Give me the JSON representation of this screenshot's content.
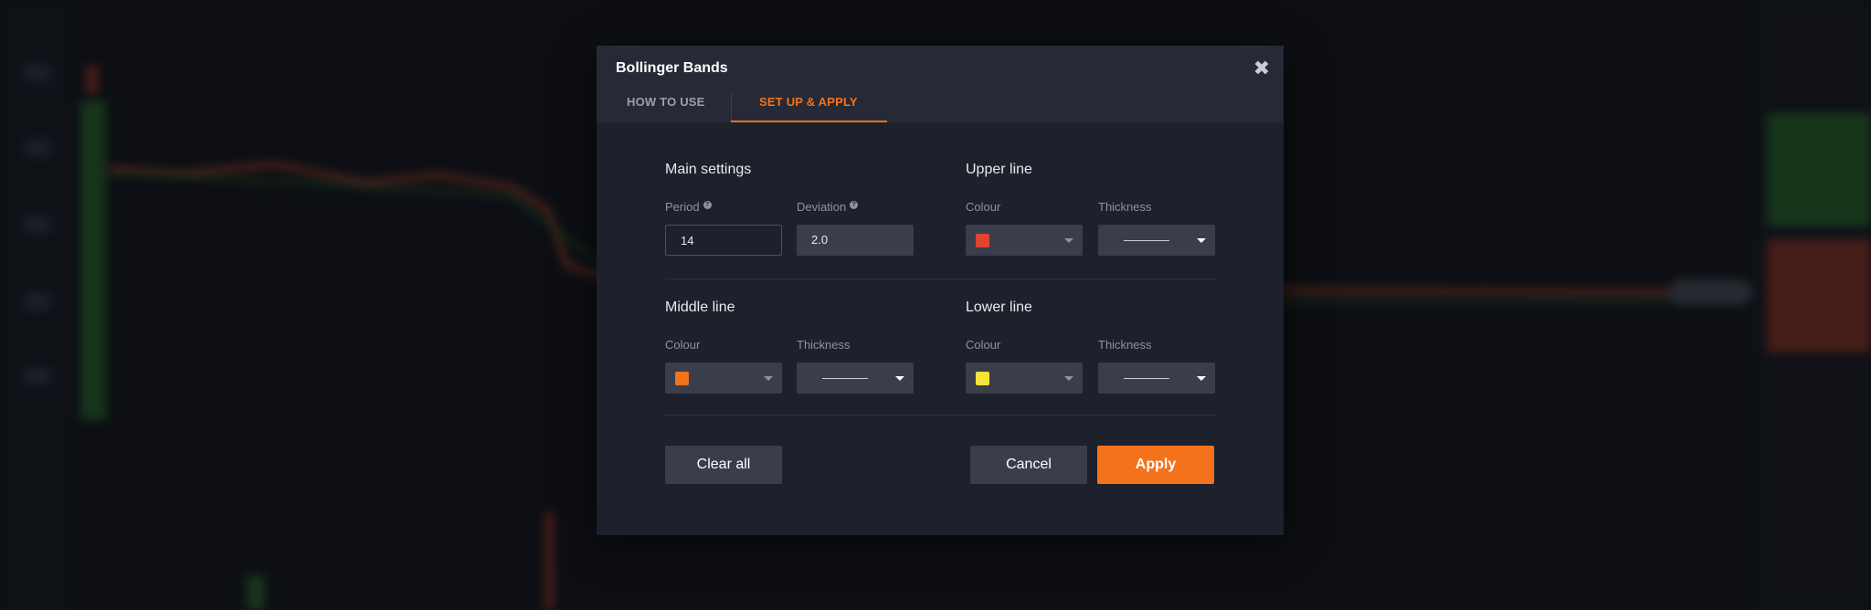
{
  "dialog": {
    "title": "Bollinger Bands",
    "close_icon": "close-icon",
    "tabs": [
      {
        "label": "HOW TO USE",
        "active": false
      },
      {
        "label": "SET UP & APPLY",
        "active": true
      }
    ]
  },
  "main_settings": {
    "title": "Main settings",
    "period": {
      "label": "Period",
      "value": "14"
    },
    "deviation": {
      "label": "Deviation",
      "value": "2.0"
    }
  },
  "upper_line": {
    "title": "Upper line",
    "colour_label": "Colour",
    "colour": "#e0452f",
    "thickness_label": "Thickness"
  },
  "middle_line": {
    "title": "Middle line",
    "colour_label": "Colour",
    "colour": "#f4721b",
    "thickness_label": "Thickness"
  },
  "lower_line": {
    "title": "Lower line",
    "colour_label": "Colour",
    "colour": "#f7e23b",
    "thickness_label": "Thickness"
  },
  "buttons": {
    "clear": "Clear all",
    "cancel": "Cancel",
    "apply": "Apply"
  },
  "colors": {
    "accent": "#f4721b",
    "modal_bg": "#1d212c",
    "header_bg": "#262a36"
  }
}
